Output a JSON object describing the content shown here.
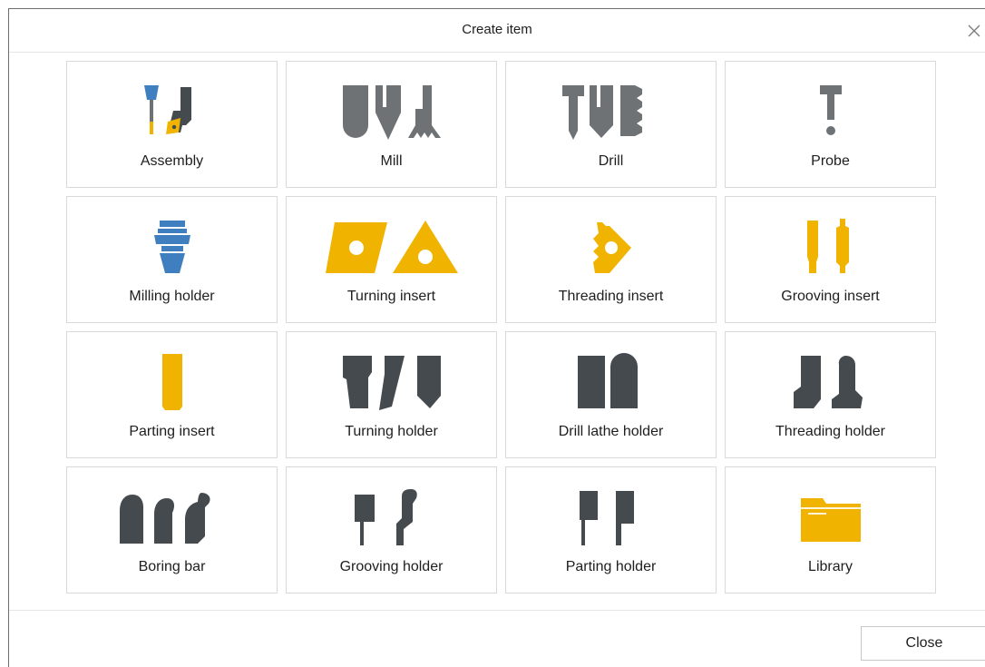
{
  "dialog": {
    "title": "Create item",
    "close_label": "Close"
  },
  "colors": {
    "blue": "#3f7fbf",
    "yellow": "#f0b400",
    "gray": "#6f7274",
    "dark": "#454a4f"
  },
  "items": [
    {
      "label": "Assembly",
      "icon": "assembly-icon"
    },
    {
      "label": "Mill",
      "icon": "mill-icon"
    },
    {
      "label": "Drill",
      "icon": "drill-icon"
    },
    {
      "label": "Probe",
      "icon": "probe-icon"
    },
    {
      "label": "Milling holder",
      "icon": "milling-holder-icon"
    },
    {
      "label": "Turning insert",
      "icon": "turning-insert-icon"
    },
    {
      "label": "Threading insert",
      "icon": "threading-insert-icon"
    },
    {
      "label": "Grooving insert",
      "icon": "grooving-insert-icon"
    },
    {
      "label": "Parting insert",
      "icon": "parting-insert-icon"
    },
    {
      "label": "Turning holder",
      "icon": "turning-holder-icon"
    },
    {
      "label": "Drill lathe holder",
      "icon": "drill-lathe-holder-icon"
    },
    {
      "label": "Threading holder",
      "icon": "threading-holder-icon"
    },
    {
      "label": "Boring bar",
      "icon": "boring-bar-icon"
    },
    {
      "label": "Grooving holder",
      "icon": "grooving-holder-icon"
    },
    {
      "label": "Parting holder",
      "icon": "parting-holder-icon"
    },
    {
      "label": "Library",
      "icon": "folder-icon"
    }
  ]
}
